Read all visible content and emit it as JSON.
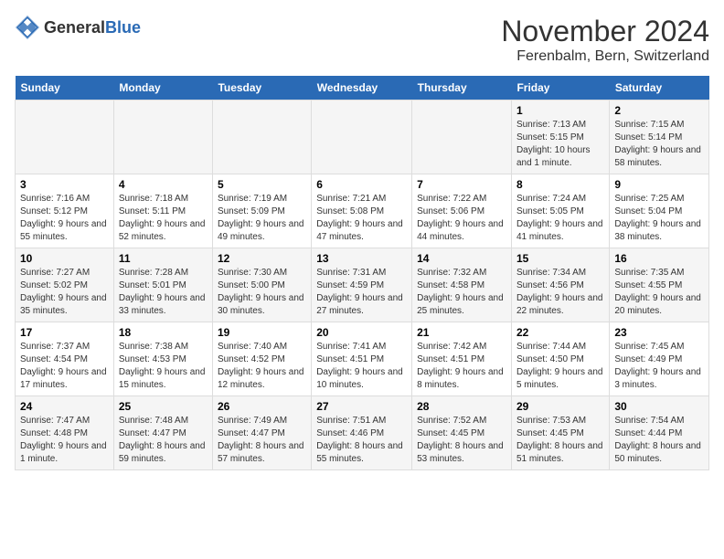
{
  "logo": {
    "text_general": "General",
    "text_blue": "Blue"
  },
  "title": {
    "month": "November 2024",
    "location": "Ferenbalm, Bern, Switzerland"
  },
  "weekdays": [
    "Sunday",
    "Monday",
    "Tuesday",
    "Wednesday",
    "Thursday",
    "Friday",
    "Saturday"
  ],
  "weeks": [
    [
      {
        "day": "",
        "info": ""
      },
      {
        "day": "",
        "info": ""
      },
      {
        "day": "",
        "info": ""
      },
      {
        "day": "",
        "info": ""
      },
      {
        "day": "",
        "info": ""
      },
      {
        "day": "1",
        "info": "Sunrise: 7:13 AM\nSunset: 5:15 PM\nDaylight: 10 hours and 1 minute."
      },
      {
        "day": "2",
        "info": "Sunrise: 7:15 AM\nSunset: 5:14 PM\nDaylight: 9 hours and 58 minutes."
      }
    ],
    [
      {
        "day": "3",
        "info": "Sunrise: 7:16 AM\nSunset: 5:12 PM\nDaylight: 9 hours and 55 minutes."
      },
      {
        "day": "4",
        "info": "Sunrise: 7:18 AM\nSunset: 5:11 PM\nDaylight: 9 hours and 52 minutes."
      },
      {
        "day": "5",
        "info": "Sunrise: 7:19 AM\nSunset: 5:09 PM\nDaylight: 9 hours and 49 minutes."
      },
      {
        "day": "6",
        "info": "Sunrise: 7:21 AM\nSunset: 5:08 PM\nDaylight: 9 hours and 47 minutes."
      },
      {
        "day": "7",
        "info": "Sunrise: 7:22 AM\nSunset: 5:06 PM\nDaylight: 9 hours and 44 minutes."
      },
      {
        "day": "8",
        "info": "Sunrise: 7:24 AM\nSunset: 5:05 PM\nDaylight: 9 hours and 41 minutes."
      },
      {
        "day": "9",
        "info": "Sunrise: 7:25 AM\nSunset: 5:04 PM\nDaylight: 9 hours and 38 minutes."
      }
    ],
    [
      {
        "day": "10",
        "info": "Sunrise: 7:27 AM\nSunset: 5:02 PM\nDaylight: 9 hours and 35 minutes."
      },
      {
        "day": "11",
        "info": "Sunrise: 7:28 AM\nSunset: 5:01 PM\nDaylight: 9 hours and 33 minutes."
      },
      {
        "day": "12",
        "info": "Sunrise: 7:30 AM\nSunset: 5:00 PM\nDaylight: 9 hours and 30 minutes."
      },
      {
        "day": "13",
        "info": "Sunrise: 7:31 AM\nSunset: 4:59 PM\nDaylight: 9 hours and 27 minutes."
      },
      {
        "day": "14",
        "info": "Sunrise: 7:32 AM\nSunset: 4:58 PM\nDaylight: 9 hours and 25 minutes."
      },
      {
        "day": "15",
        "info": "Sunrise: 7:34 AM\nSunset: 4:56 PM\nDaylight: 9 hours and 22 minutes."
      },
      {
        "day": "16",
        "info": "Sunrise: 7:35 AM\nSunset: 4:55 PM\nDaylight: 9 hours and 20 minutes."
      }
    ],
    [
      {
        "day": "17",
        "info": "Sunrise: 7:37 AM\nSunset: 4:54 PM\nDaylight: 9 hours and 17 minutes."
      },
      {
        "day": "18",
        "info": "Sunrise: 7:38 AM\nSunset: 4:53 PM\nDaylight: 9 hours and 15 minutes."
      },
      {
        "day": "19",
        "info": "Sunrise: 7:40 AM\nSunset: 4:52 PM\nDaylight: 9 hours and 12 minutes."
      },
      {
        "day": "20",
        "info": "Sunrise: 7:41 AM\nSunset: 4:51 PM\nDaylight: 9 hours and 10 minutes."
      },
      {
        "day": "21",
        "info": "Sunrise: 7:42 AM\nSunset: 4:51 PM\nDaylight: 9 hours and 8 minutes."
      },
      {
        "day": "22",
        "info": "Sunrise: 7:44 AM\nSunset: 4:50 PM\nDaylight: 9 hours and 5 minutes."
      },
      {
        "day": "23",
        "info": "Sunrise: 7:45 AM\nSunset: 4:49 PM\nDaylight: 9 hours and 3 minutes."
      }
    ],
    [
      {
        "day": "24",
        "info": "Sunrise: 7:47 AM\nSunset: 4:48 PM\nDaylight: 9 hours and 1 minute."
      },
      {
        "day": "25",
        "info": "Sunrise: 7:48 AM\nSunset: 4:47 PM\nDaylight: 8 hours and 59 minutes."
      },
      {
        "day": "26",
        "info": "Sunrise: 7:49 AM\nSunset: 4:47 PM\nDaylight: 8 hours and 57 minutes."
      },
      {
        "day": "27",
        "info": "Sunrise: 7:51 AM\nSunset: 4:46 PM\nDaylight: 8 hours and 55 minutes."
      },
      {
        "day": "28",
        "info": "Sunrise: 7:52 AM\nSunset: 4:45 PM\nDaylight: 8 hours and 53 minutes."
      },
      {
        "day": "29",
        "info": "Sunrise: 7:53 AM\nSunset: 4:45 PM\nDaylight: 8 hours and 51 minutes."
      },
      {
        "day": "30",
        "info": "Sunrise: 7:54 AM\nSunset: 4:44 PM\nDaylight: 8 hours and 50 minutes."
      }
    ]
  ]
}
